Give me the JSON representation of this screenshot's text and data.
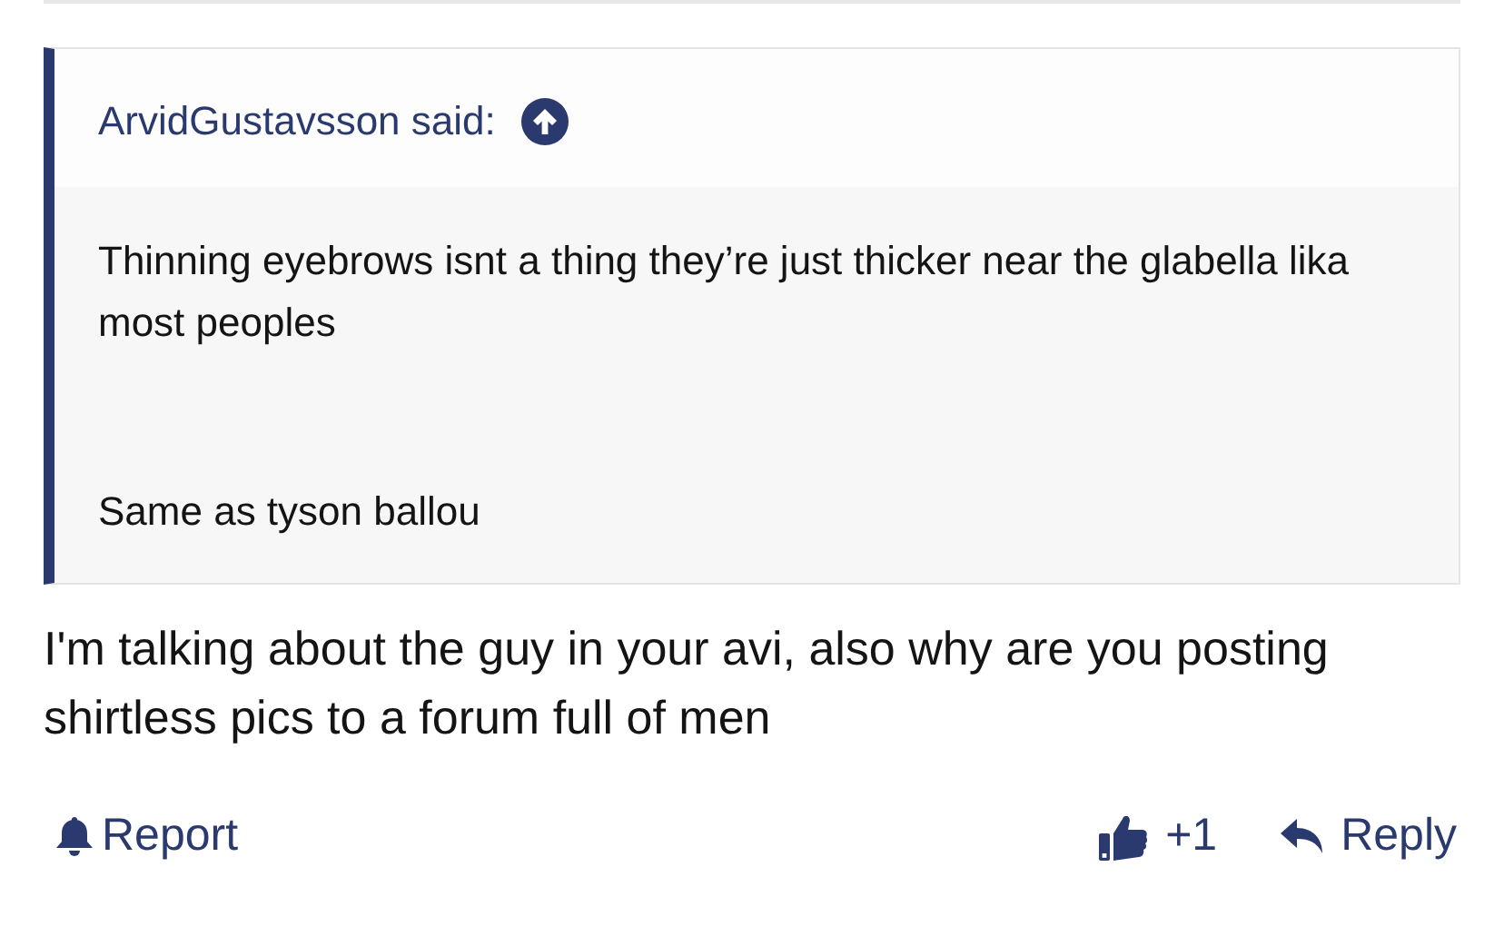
{
  "quote": {
    "author_line": "ArvidGustavsson said:",
    "paragraphs": [
      "Thinning eyebrows isnt a thing they’re just thicker near the glabella lika most peoples",
      "Same as tyson ballou"
    ]
  },
  "message": "I'm talking about the guy in your avi, also why are you posting shirtless pics to a forum full of men",
  "actions": {
    "report": "Report",
    "like_count": "+1",
    "reply": "Reply"
  }
}
